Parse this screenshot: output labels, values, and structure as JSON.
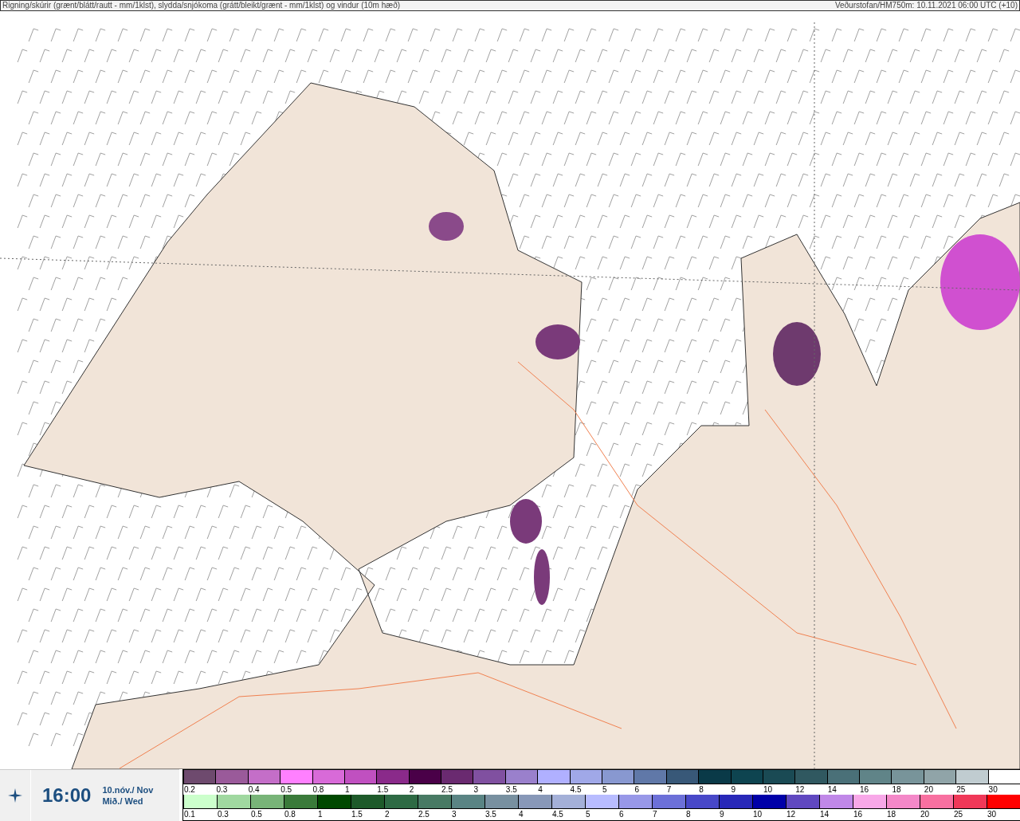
{
  "header": {
    "title": "Rigning/skúrir (grænt/blátt/rautt - mm/1klst), slydda/snjókoma (grátt/bleikt/grænt - mm/1klst) og vindur (10m hæð)",
    "source": "Veðurstofan/HM750m: 10.11.2021 06:00 UTC (+10)"
  },
  "footer": {
    "time": "16:00",
    "date_line": "10.nóv./ Nov",
    "day_line": "Mið./ Wed"
  },
  "legend": {
    "sleet_scale": [
      {
        "label": "0.2",
        "color": "#6e4a6e"
      },
      {
        "label": "0.3",
        "color": "#9a5a9a"
      },
      {
        "label": "0.4",
        "color": "#c46ec8"
      },
      {
        "label": "0.5",
        "color": "#ff80ff"
      },
      {
        "label": "0.8",
        "color": "#d86ad8"
      },
      {
        "label": "1",
        "color": "#c050c0"
      },
      {
        "label": "1.5",
        "color": "#8a2a8a"
      },
      {
        "label": "2",
        "color": "#4a0048"
      },
      {
        "label": "2.5",
        "color": "#6a2a70"
      },
      {
        "label": "3",
        "color": "#8050a0"
      },
      {
        "label": "3.5",
        "color": "#9a80cc"
      },
      {
        "label": "4",
        "color": "#b0b0ff"
      },
      {
        "label": "4.5",
        "color": "#a0a8e8"
      },
      {
        "label": "5",
        "color": "#8898d0"
      },
      {
        "label": "6",
        "color": "#6078a8"
      },
      {
        "label": "7",
        "color": "#385878"
      },
      {
        "label": "8",
        "color": "#0a3a48"
      },
      {
        "label": "9",
        "color": "#0e4450"
      },
      {
        "label": "10",
        "color": "#1a4a54"
      },
      {
        "label": "12",
        "color": "#305860"
      },
      {
        "label": "14",
        "color": "#4a7078"
      },
      {
        "label": "16",
        "color": "#608488"
      },
      {
        "label": "18",
        "color": "#78949a"
      },
      {
        "label": "20",
        "color": "#90a4a8"
      },
      {
        "label": "25",
        "color": "#c0ccd0"
      },
      {
        "label": "30",
        "color": "#ffffff"
      }
    ],
    "rain_scale": [
      {
        "label": "0.1",
        "color": "#ccffcc"
      },
      {
        "label": "0.3",
        "color": "#a0d8a0"
      },
      {
        "label": "0.5",
        "color": "#78b478"
      },
      {
        "label": "0.8",
        "color": "#3a7a3a"
      },
      {
        "label": "1",
        "color": "#004800"
      },
      {
        "label": "1.5",
        "color": "#1e5a2a"
      },
      {
        "label": "2",
        "color": "#2e6a44"
      },
      {
        "label": "2.5",
        "color": "#487a64"
      },
      {
        "label": "3",
        "color": "#5a8484"
      },
      {
        "label": "3.5",
        "color": "#7890a0"
      },
      {
        "label": "4",
        "color": "#8898b8"
      },
      {
        "label": "4.5",
        "color": "#a4b0d8"
      },
      {
        "label": "5",
        "color": "#b8bcff"
      },
      {
        "label": "6",
        "color": "#9898e8"
      },
      {
        "label": "7",
        "color": "#6c70d8"
      },
      {
        "label": "8",
        "color": "#4848c8"
      },
      {
        "label": "9",
        "color": "#2828b8"
      },
      {
        "label": "10",
        "color": "#0000a8"
      },
      {
        "label": "12",
        "color": "#6048c0"
      },
      {
        "label": "14",
        "color": "#c088e8"
      },
      {
        "label": "16",
        "color": "#f8a8e8"
      },
      {
        "label": "18",
        "color": "#f488c8"
      },
      {
        "label": "20",
        "color": "#f870a0"
      },
      {
        "label": "25",
        "color": "#f03858"
      },
      {
        "label": "30",
        "color": "#ff0000"
      }
    ]
  }
}
